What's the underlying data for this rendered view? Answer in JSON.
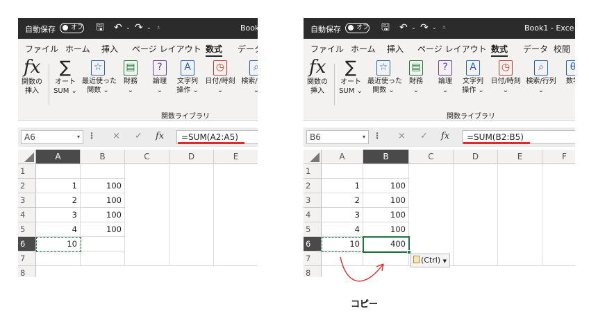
{
  "titlebar": {
    "autosave": "自動保存",
    "toggle": "オフ",
    "save_icon": "save-icon",
    "undo_icon": "undo-icon",
    "redo_icon": "redo-icon",
    "left_doc_title": "Book",
    "right_doc_title": "Book1  -  Exce"
  },
  "tabs": {
    "left": [
      "ファイル",
      "ホーム",
      "挿入",
      "ページ レイアウト",
      "数式",
      "データ"
    ],
    "right": [
      "ファイル",
      "ホーム",
      "挿入",
      "ページ レイアウト",
      "数式",
      "データ",
      "校閲"
    ],
    "active": "数式"
  },
  "ribbon": {
    "buttons": [
      {
        "icon": "function-icon",
        "glyph": "fx",
        "line1": "関数の",
        "line2": "挿入"
      },
      {
        "icon": "autosum-icon",
        "glyph": "∑",
        "line1": "オート",
        "line2": "SUM ⌄"
      },
      {
        "icon": "recent-functions-icon",
        "glyph": "☆",
        "line1": "最近使った",
        "line2": "関数 ⌄"
      },
      {
        "icon": "financial-icon",
        "glyph": "▤",
        "line1": "財務",
        "line2": "⌄"
      },
      {
        "icon": "logical-icon",
        "glyph": "?",
        "line1": "論理",
        "line2": "⌄"
      },
      {
        "icon": "text-icon",
        "glyph": "A",
        "line1": "文字列",
        "line2": "操作 ⌄"
      },
      {
        "icon": "datetime-icon",
        "glyph": "◷",
        "line1": "日付/時刻",
        "line2": "⌄"
      },
      {
        "icon": "lookup-icon",
        "glyph": "⌕",
        "line1": "検索/行列",
        "line2": "⌄"
      },
      {
        "icon": "math-icon",
        "glyph": "θ",
        "line1": "数学",
        "line2": ""
      }
    ],
    "group_label": "関数ライブラリ"
  },
  "formula_bar": {
    "left": {
      "namebox": "A6",
      "formula": "=SUM(A2:A5)"
    },
    "right": {
      "namebox": "B6",
      "formula": "=SUM(B2:B5)"
    },
    "cancel": "×",
    "enter": "✓",
    "fx": "fx"
  },
  "sheet": {
    "left_columns": [
      "A",
      "B",
      "C",
      "D",
      "E"
    ],
    "right_columns": [
      "A",
      "B",
      "C",
      "D",
      "E",
      "F"
    ],
    "rows": [
      "1",
      "2",
      "3",
      "4",
      "5",
      "6",
      "7",
      "8"
    ],
    "left_cells": [
      [
        "",
        ""
      ],
      [
        "1",
        "100"
      ],
      [
        "2",
        "100"
      ],
      [
        "3",
        "100"
      ],
      [
        "4",
        "100"
      ],
      [
        "10",
        ""
      ],
      [
        "",
        ""
      ]
    ],
    "right_cells": [
      [
        "",
        ""
      ],
      [
        "1",
        "100"
      ],
      [
        "2",
        "100"
      ],
      [
        "3",
        "100"
      ],
      [
        "4",
        "100"
      ],
      [
        "10",
        "400"
      ],
      [
        "",
        ""
      ]
    ]
  },
  "paste_options": "(Ctrl)",
  "caption": "コピー",
  "colors": {
    "excel_green": "#217346",
    "underline_red": "#e0282e",
    "titlebar": "#2b2b2b",
    "ribbon_bg": "#f3f2f1"
  }
}
